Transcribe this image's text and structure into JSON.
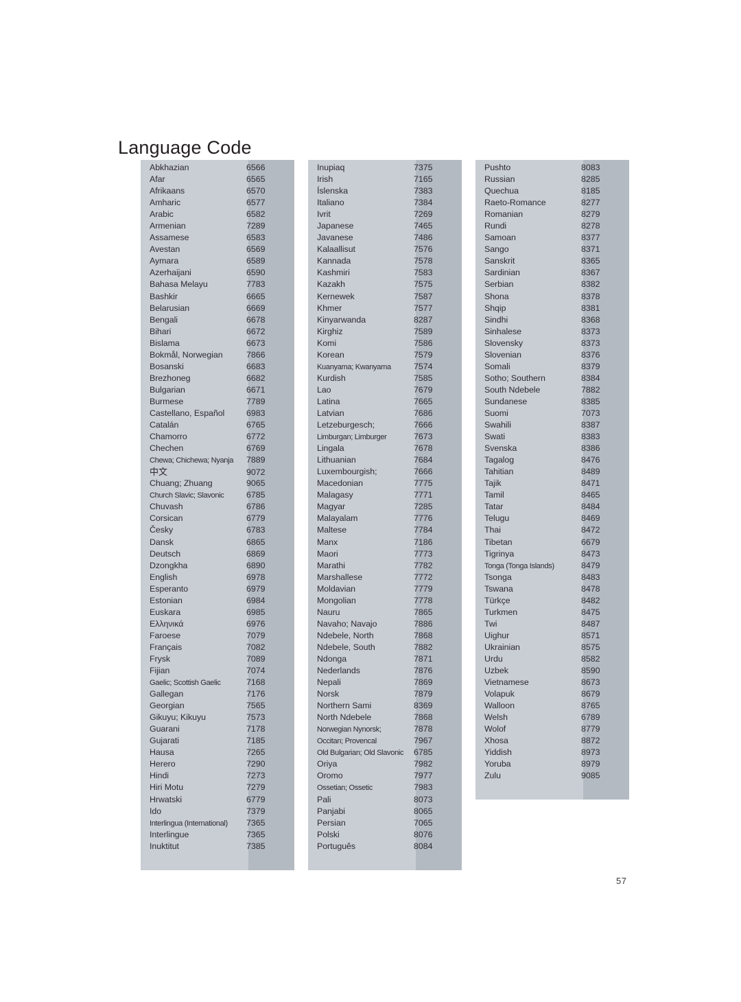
{
  "document": {
    "title": "Language Code",
    "page_number": "57",
    "colors": {
      "block_background": "#c9cdd4",
      "code_band_background": "#b4bac2",
      "text": "#2b2b2f",
      "page_background": "#ffffff"
    }
  },
  "columns": [
    {
      "id": "column-1",
      "rows": [
        {
          "name": "Abkhazian",
          "code": "6566"
        },
        {
          "name": "Afar",
          "code": "6565"
        },
        {
          "name": "Afrikaans",
          "code": "6570"
        },
        {
          "name": "Amharic",
          "code": "6577"
        },
        {
          "name": "Arabic",
          "code": "6582"
        },
        {
          "name": "Armenian",
          "code": "7289"
        },
        {
          "name": "Assamese",
          "code": "6583"
        },
        {
          "name": "Avestan",
          "code": "6569"
        },
        {
          "name": "Aymara",
          "code": "6589"
        },
        {
          "name": "Azerhaijani",
          "code": "6590"
        },
        {
          "name": "Bahasa Melayu",
          "code": "7783"
        },
        {
          "name": "Bashkir",
          "code": "6665"
        },
        {
          "name": "Belarusian",
          "code": "6669"
        },
        {
          "name": "Bengali",
          "code": "6678"
        },
        {
          "name": "Bihari",
          "code": "6672"
        },
        {
          "name": "Bislama",
          "code": "6673"
        },
        {
          "name": "Bokmål, Norwegian",
          "code": "7866"
        },
        {
          "name": "Bosanski",
          "code": "6683"
        },
        {
          "name": "Brezhoneg",
          "code": "6682"
        },
        {
          "name": "Bulgarian",
          "code": "6671"
        },
        {
          "name": "Burmese",
          "code": "7789"
        },
        {
          "name": "Castellano, Español",
          "code": "6983"
        },
        {
          "name": "Catalán",
          "code": "6765"
        },
        {
          "name": "Chamorro",
          "code": "6772"
        },
        {
          "name": "Chechen",
          "code": "6769"
        },
        {
          "name": "Chewa; Chichewa; Nyanja",
          "code": "7889",
          "tight": true
        },
        {
          "name": "中文",
          "code": "9072",
          "cjk": true
        },
        {
          "name": "Chuang; Zhuang",
          "code": "9065"
        },
        {
          "name": "Church Slavic; Slavonic",
          "code": "6785",
          "tight": true
        },
        {
          "name": "Chuvash",
          "code": "6786"
        },
        {
          "name": "Corsican",
          "code": "6779"
        },
        {
          "name": "Česky",
          "code": "6783"
        },
        {
          "name": "Dansk",
          "code": "6865"
        },
        {
          "name": "Deutsch",
          "code": "6869"
        },
        {
          "name": "Dzongkha",
          "code": "6890"
        },
        {
          "name": "English",
          "code": "6978"
        },
        {
          "name": "Esperanto",
          "code": "6979"
        },
        {
          "name": "Estonian",
          "code": "6984"
        },
        {
          "name": "Euskara",
          "code": "6985"
        },
        {
          "name": "Ελληνικά",
          "code": "6976"
        },
        {
          "name": "Faroese",
          "code": "7079"
        },
        {
          "name": "Français",
          "code": "7082"
        },
        {
          "name": "Frysk",
          "code": "7089"
        },
        {
          "name": "Fijian",
          "code": "7074"
        },
        {
          "name": "Gaelic; Scottish Gaelic",
          "code": "7168",
          "tight": true
        },
        {
          "name": "Gallegan",
          "code": "7176"
        },
        {
          "name": "Georgian",
          "code": "7565"
        },
        {
          "name": "Gikuyu; Kikuyu",
          "code": "7573"
        },
        {
          "name": "Guarani",
          "code": "7178"
        },
        {
          "name": "Gujarati",
          "code": "7185"
        },
        {
          "name": "Hausa",
          "code": "7265"
        },
        {
          "name": "Herero",
          "code": "7290"
        },
        {
          "name": "Hindi",
          "code": "7273"
        },
        {
          "name": "Hiri Motu",
          "code": "7279"
        },
        {
          "name": "Hrwatski",
          "code": "6779"
        },
        {
          "name": "Ido",
          "code": "7379"
        },
        {
          "name": "Interlingua (International)",
          "code": "7365",
          "tight": true
        },
        {
          "name": "Interlingue",
          "code": "7365"
        },
        {
          "name": "Inuktitut",
          "code": "7385"
        }
      ]
    },
    {
      "id": "column-2",
      "rows": [
        {
          "name": "Inupiaq",
          "code": "7375"
        },
        {
          "name": "Irish",
          "code": "7165"
        },
        {
          "name": "Íslenska",
          "code": "7383"
        },
        {
          "name": "Italiano",
          "code": "7384"
        },
        {
          "name": "Ivrit",
          "code": "7269"
        },
        {
          "name": "Japanese",
          "code": "7465"
        },
        {
          "name": "Javanese",
          "code": "7486"
        },
        {
          "name": "Kalaallisut",
          "code": "7576"
        },
        {
          "name": "Kannada",
          "code": "7578"
        },
        {
          "name": "Kashmiri",
          "code": "7583"
        },
        {
          "name": "Kazakh",
          "code": "7575"
        },
        {
          "name": "Kernewek",
          "code": "7587"
        },
        {
          "name": "Khmer",
          "code": "7577"
        },
        {
          "name": "Kinyarwanda",
          "code": "8287"
        },
        {
          "name": "Kirghiz",
          "code": "7589"
        },
        {
          "name": "Komi",
          "code": "7586"
        },
        {
          "name": "Korean",
          "code": "7579"
        },
        {
          "name": "Kuanyama; Kwanyama",
          "code": "7574",
          "tight": true
        },
        {
          "name": "Kurdish",
          "code": "7585"
        },
        {
          "name": "Lao",
          "code": "7679"
        },
        {
          "name": "Latina",
          "code": "7665"
        },
        {
          "name": "Latvian",
          "code": "7686"
        },
        {
          "name": "Letzeburgesch;",
          "code": "7666"
        },
        {
          "name": "Limburgan; Limburger",
          "code": "7673",
          "tight": true
        },
        {
          "name": "Lingala",
          "code": "7678"
        },
        {
          "name": "Lithuanian",
          "code": "7684"
        },
        {
          "name": "Luxembourgish;",
          "code": "7666"
        },
        {
          "name": "Macedonian",
          "code": "7775"
        },
        {
          "name": "Malagasy",
          "code": "7771"
        },
        {
          "name": "Magyar",
          "code": "7285"
        },
        {
          "name": "Malayalam",
          "code": "7776"
        },
        {
          "name": "Maltese",
          "code": "7784"
        },
        {
          "name": "Manx",
          "code": "7186"
        },
        {
          "name": "Maori",
          "code": "7773"
        },
        {
          "name": "Marathi",
          "code": "7782"
        },
        {
          "name": "Marshallese",
          "code": "7772"
        },
        {
          "name": "Moldavian",
          "code": "7779"
        },
        {
          "name": "Mongolian",
          "code": "7778"
        },
        {
          "name": "Nauru",
          "code": "7865"
        },
        {
          "name": "Navaho; Navajo",
          "code": "7886"
        },
        {
          "name": "Ndebele, North",
          "code": "7868"
        },
        {
          "name": "Ndebele, South",
          "code": "7882"
        },
        {
          "name": "Ndonga",
          "code": "7871"
        },
        {
          "name": "Nederlands",
          "code": "7876"
        },
        {
          "name": "Nepali",
          "code": "7869"
        },
        {
          "name": "Norsk",
          "code": "7879"
        },
        {
          "name": "Northern Sami",
          "code": "8369"
        },
        {
          "name": "North Ndebele",
          "code": "7868"
        },
        {
          "name": "Norwegian Nynorsk;",
          "code": "7878",
          "tight": true
        },
        {
          "name": "Occitan; Provencal",
          "code": "7967",
          "tight": true
        },
        {
          "name": "Old Bulgarian; Old Slavonic",
          "code": "6785",
          "tight": true
        },
        {
          "name": "Oriya",
          "code": "7982"
        },
        {
          "name": "Oromo",
          "code": "7977"
        },
        {
          "name": "Ossetian; Ossetic",
          "code": "7983",
          "tight": true
        },
        {
          "name": "Pali",
          "code": "8073"
        },
        {
          "name": "Panjabi",
          "code": "8065"
        },
        {
          "name": "Persian",
          "code": "7065"
        },
        {
          "name": "Polski",
          "code": "8076"
        },
        {
          "name": "Português",
          "code": "8084"
        }
      ]
    },
    {
      "id": "column-3",
      "rows": [
        {
          "name": "Pushto",
          "code": "8083"
        },
        {
          "name": "Russian",
          "code": "8285"
        },
        {
          "name": "Quechua",
          "code": "8185"
        },
        {
          "name": "Raeto-Romance",
          "code": "8277"
        },
        {
          "name": "Romanian",
          "code": "8279"
        },
        {
          "name": "Rundi",
          "code": "8278"
        },
        {
          "name": "Samoan",
          "code": "8377"
        },
        {
          "name": "Sango",
          "code": "8371"
        },
        {
          "name": "Sanskrit",
          "code": "8365"
        },
        {
          "name": "Sardinian",
          "code": "8367"
        },
        {
          "name": "Serbian",
          "code": "8382"
        },
        {
          "name": "Shona",
          "code": "8378"
        },
        {
          "name": "Shqip",
          "code": "8381"
        },
        {
          "name": "Sindhi",
          "code": "8368"
        },
        {
          "name": "Sinhalese",
          "code": "8373"
        },
        {
          "name": "Slovensky",
          "code": "8373"
        },
        {
          "name": "Slovenian",
          "code": "8376"
        },
        {
          "name": "Somali",
          "code": "8379"
        },
        {
          "name": "Sotho; Southern",
          "code": "8384"
        },
        {
          "name": "South Ndebele",
          "code": "7882"
        },
        {
          "name": "Sundanese",
          "code": "8385"
        },
        {
          "name": "Suomi",
          "code": "7073"
        },
        {
          "name": "Swahili",
          "code": "8387"
        },
        {
          "name": "Swati",
          "code": "8383"
        },
        {
          "name": "Svenska",
          "code": "8386"
        },
        {
          "name": "Tagalog",
          "code": "8476"
        },
        {
          "name": "Tahitian",
          "code": "8489"
        },
        {
          "name": "Tajik",
          "code": "8471"
        },
        {
          "name": "Tamil",
          "code": "8465"
        },
        {
          "name": "Tatar",
          "code": "8484"
        },
        {
          "name": "Telugu",
          "code": "8469"
        },
        {
          "name": "Thai",
          "code": "8472"
        },
        {
          "name": "Tibetan",
          "code": "6679"
        },
        {
          "name": "Tigrinya",
          "code": "8473"
        },
        {
          "name": "Tonga (Tonga Islands)",
          "code": "8479",
          "tight": true
        },
        {
          "name": "Tsonga",
          "code": "8483"
        },
        {
          "name": "Tswana",
          "code": "8478"
        },
        {
          "name": "Türkçe",
          "code": "8482"
        },
        {
          "name": "Turkmen",
          "code": "8475"
        },
        {
          "name": "Twi",
          "code": "8487"
        },
        {
          "name": "Uighur",
          "code": "8571"
        },
        {
          "name": "Ukrainian",
          "code": "8575"
        },
        {
          "name": "Urdu",
          "code": "8582"
        },
        {
          "name": "Uzbek",
          "code": "8590"
        },
        {
          "name": "Vietnamese",
          "code": "8673"
        },
        {
          "name": "Volapuk",
          "code": "8679"
        },
        {
          "name": "Walloon",
          "code": "8765"
        },
        {
          "name": "Welsh",
          "code": "6789"
        },
        {
          "name": "Wolof",
          "code": "8779"
        },
        {
          "name": "Xhosa",
          "code": "8872"
        },
        {
          "name": "Yiddish",
          "code": "8973"
        },
        {
          "name": "Yoruba",
          "code": "8979"
        },
        {
          "name": "Zulu",
          "code": "9085"
        }
      ]
    }
  ]
}
